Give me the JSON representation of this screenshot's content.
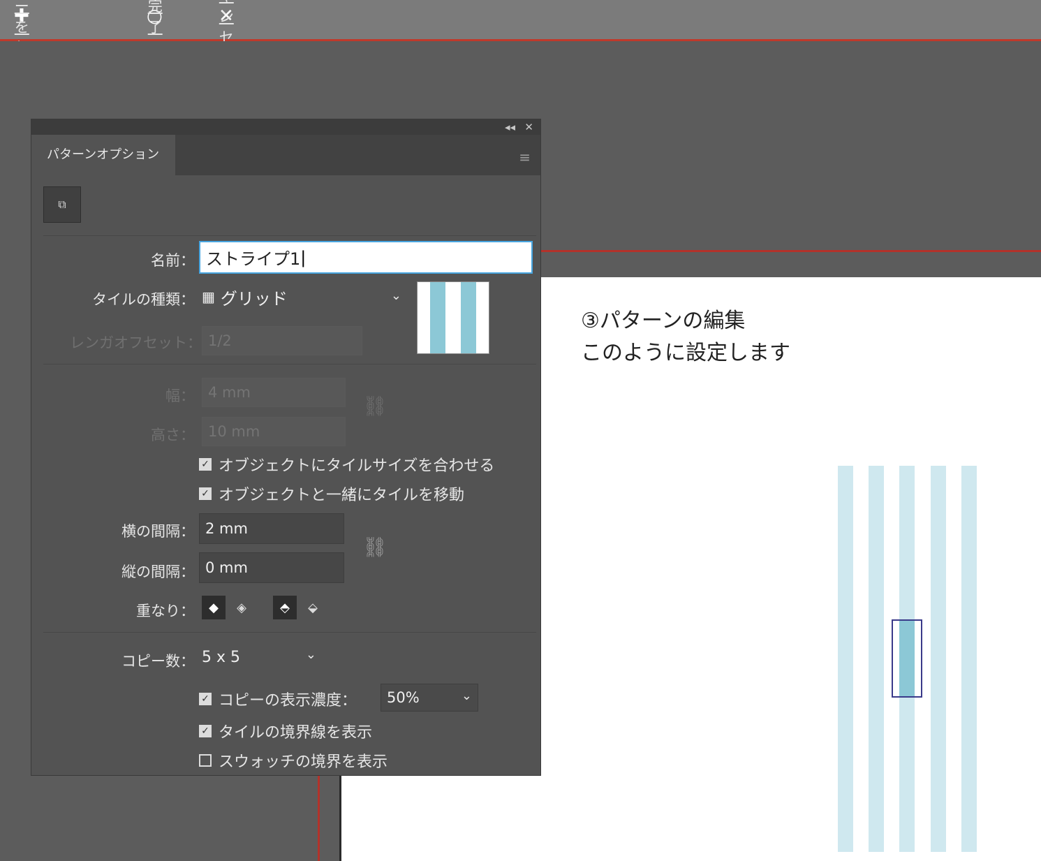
{
  "topbar": {
    "save_copy": "コピーを保存",
    "done": "完了",
    "cancel": "キャンセル"
  },
  "panel": {
    "tab_title": "パターンオプション",
    "name_label": "名前：",
    "name_value": "ストライプ1",
    "tile_type_label": "タイルの種類：",
    "tile_type_value": "グリッド",
    "brick_offset_label": "レンガオフセット：",
    "brick_offset_value": "1/2",
    "width_label": "幅：",
    "width_value": "4 mm",
    "height_label": "高さ：",
    "height_value": "10 mm",
    "fit_tile_label": "オブジェクトにタイルサイズを合わせる",
    "move_tile_label": "オブジェクトと一緒にタイルを移動",
    "h_spacing_label": "横の間隔：",
    "h_spacing_value": "2 mm",
    "v_spacing_label": "縦の間隔：",
    "v_spacing_value": "0 mm",
    "overlap_label": "重なり：",
    "copies_label": "コピー数：",
    "copies_value": "5 x 5",
    "dim_copies_label": "コピーの表示濃度：",
    "dim_copies_value": "50%",
    "show_tile_edge_label": "タイルの境界線を表示",
    "show_swatch_bounds_label": "スウォッチの境界を表示"
  },
  "caption": {
    "line1": "③パターンの編集",
    "line2": "このように設定します"
  },
  "colors": {
    "accent_red": "#c0392b",
    "stripe_light": "#cfe8ef",
    "stripe_dark": "#8cc8d6"
  }
}
